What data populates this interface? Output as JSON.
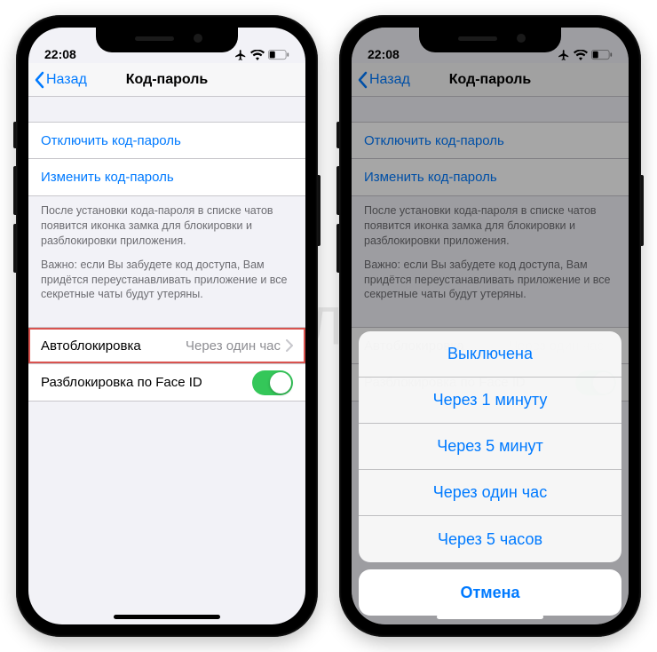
{
  "watermark": "ЯБЛЫК",
  "status": {
    "time": "22:08"
  },
  "nav": {
    "back": "Назад",
    "title": "Код-пароль"
  },
  "cells": {
    "disable": "Отключить код-пароль",
    "change": "Изменить код-пароль",
    "autolock_label": "Автоблокировка",
    "autolock_value": "Через один час",
    "faceid_label": "Разблокировка по Face ID"
  },
  "footer": {
    "p1": "После установки кода-пароля в списке чатов появится иконка замка для блокировки и разблокировки приложения.",
    "p2": "Важно: если Вы забудете код доступа, Вам придётся переустанавливать приложение и все секретные чаты будут утеряны."
  },
  "sheet": {
    "options": [
      "Выключена",
      "Через 1 минуту",
      "Через 5 минут",
      "Через один час",
      "Через 5 часов"
    ],
    "cancel": "Отмена"
  }
}
